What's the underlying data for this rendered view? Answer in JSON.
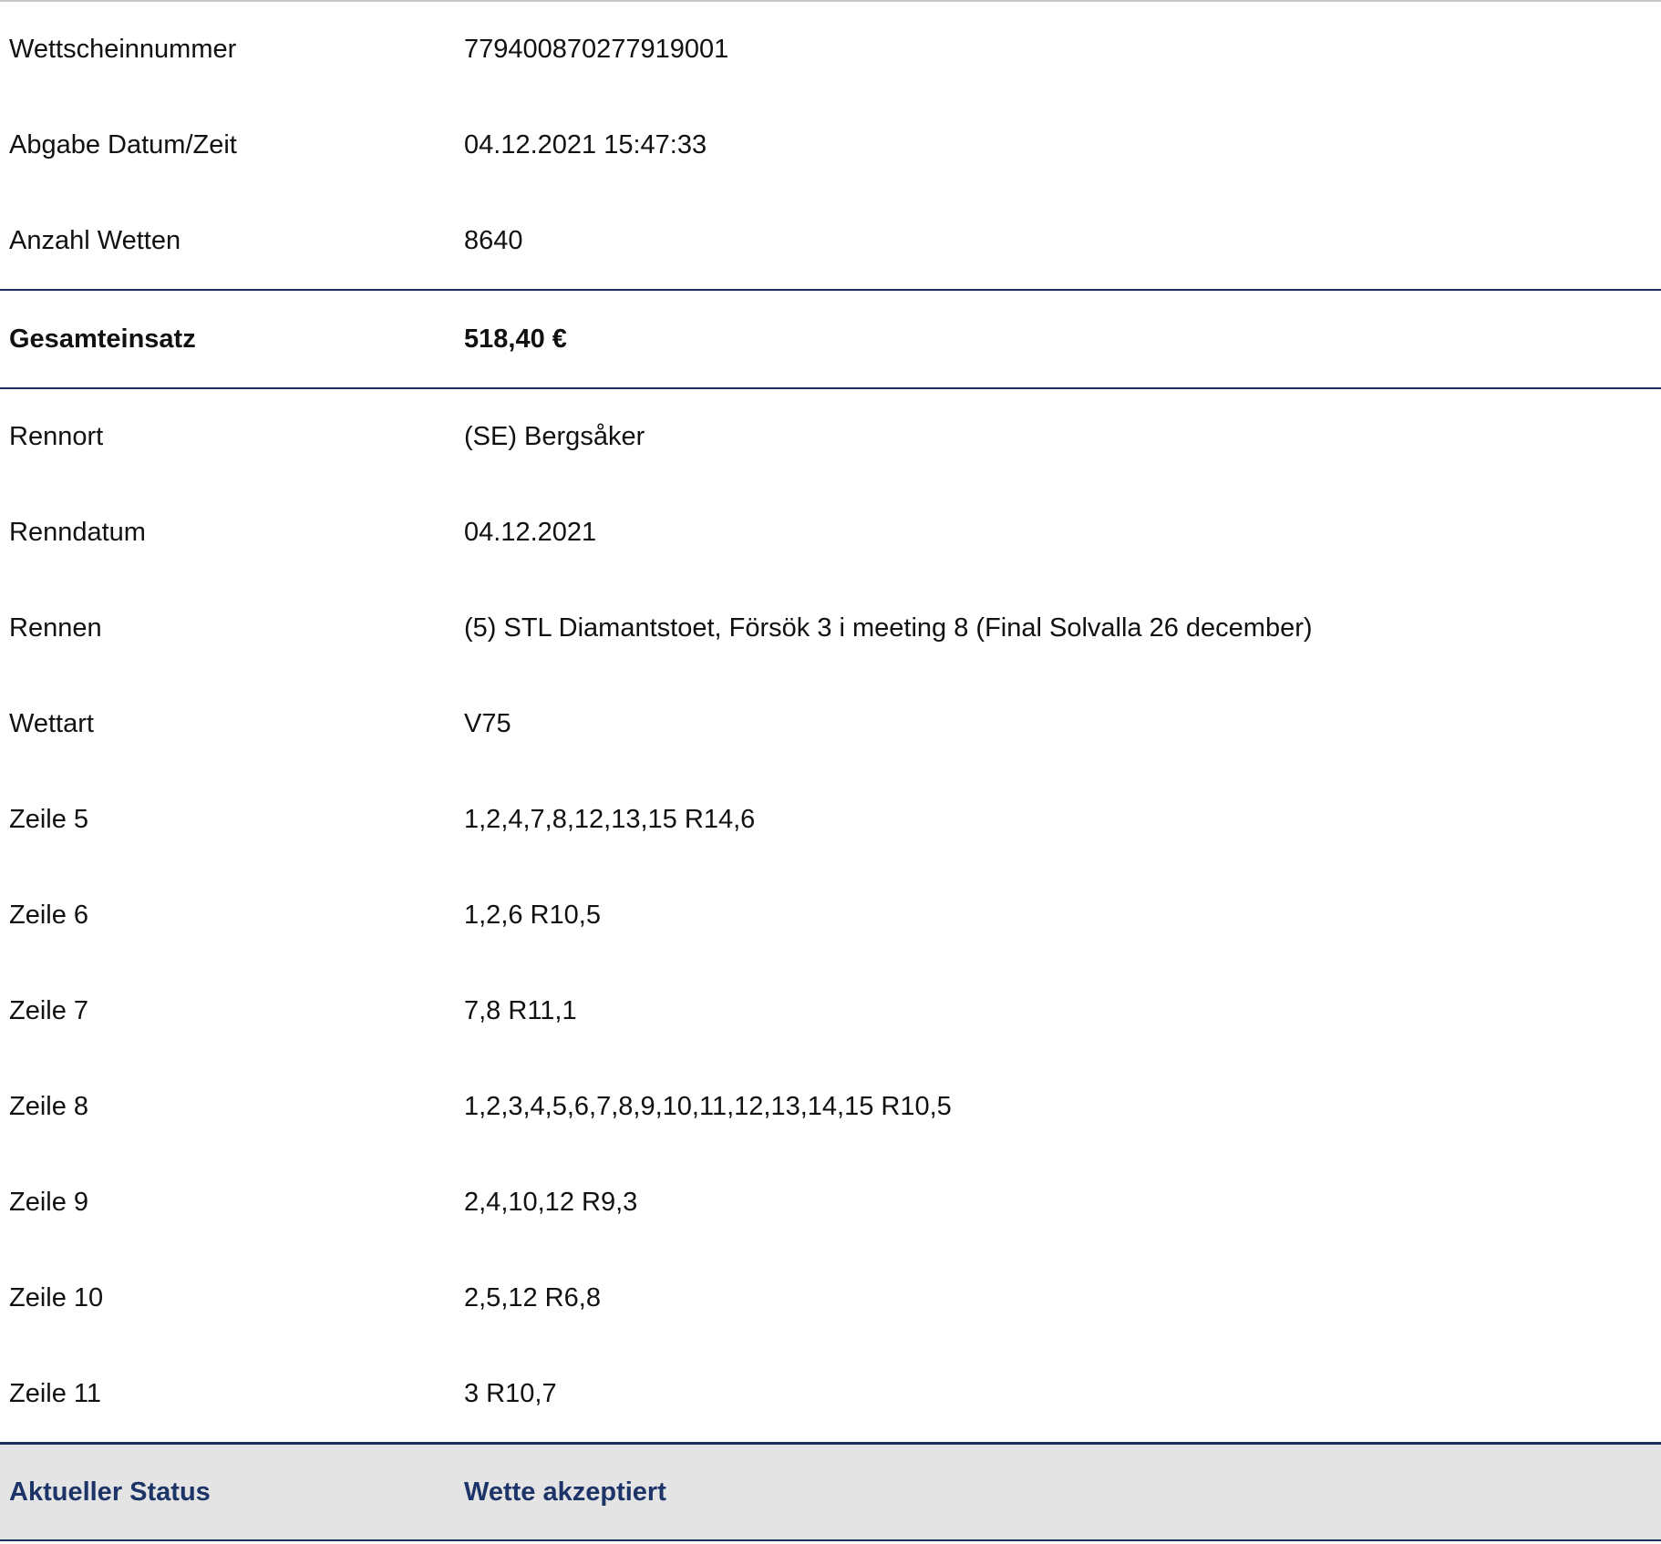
{
  "ticket": {
    "rows_top": [
      {
        "label": "Wettscheinnummer",
        "value": "779400870277919001"
      },
      {
        "label": "Abgabe Datum/Zeit",
        "value": "04.12.2021 15:47:33"
      },
      {
        "label": "Anzahl Wetten",
        "value": "8640"
      }
    ],
    "total": {
      "label": "Gesamteinsatz",
      "value": "518,40 €"
    },
    "rows_details": [
      {
        "label": "Rennort",
        "value": "(SE) Bergsåker"
      },
      {
        "label": "Renndatum",
        "value": "04.12.2021"
      },
      {
        "label": "Rennen",
        "value": "(5) STL Diamantstoet, Försök 3 i meeting 8 (Final Solvalla 26 december)"
      },
      {
        "label": "Wettart",
        "value": "V75"
      },
      {
        "label": "Zeile 5",
        "value": "1,2,4,7,8,12,13,15 R14,6"
      },
      {
        "label": "Zeile 6",
        "value": "1,2,6 R10,5"
      },
      {
        "label": "Zeile 7",
        "value": "7,8 R11,1"
      },
      {
        "label": "Zeile 8",
        "value": "1,2,3,4,5,6,7,8,9,10,11,12,13,14,15 R10,5"
      },
      {
        "label": "Zeile 9",
        "value": "2,4,10,12 R9,3"
      },
      {
        "label": "Zeile 10",
        "value": "2,5,12 R6,8"
      },
      {
        "label": "Zeile 11",
        "value": "3 R10,7"
      }
    ],
    "status": {
      "label": "Aktueller Status",
      "value": "Wette akzeptiert"
    }
  },
  "colors": {
    "accent_navy": "#1c2e5c",
    "status_text": "#1c3468",
    "status_background": "#e4e4e4"
  }
}
